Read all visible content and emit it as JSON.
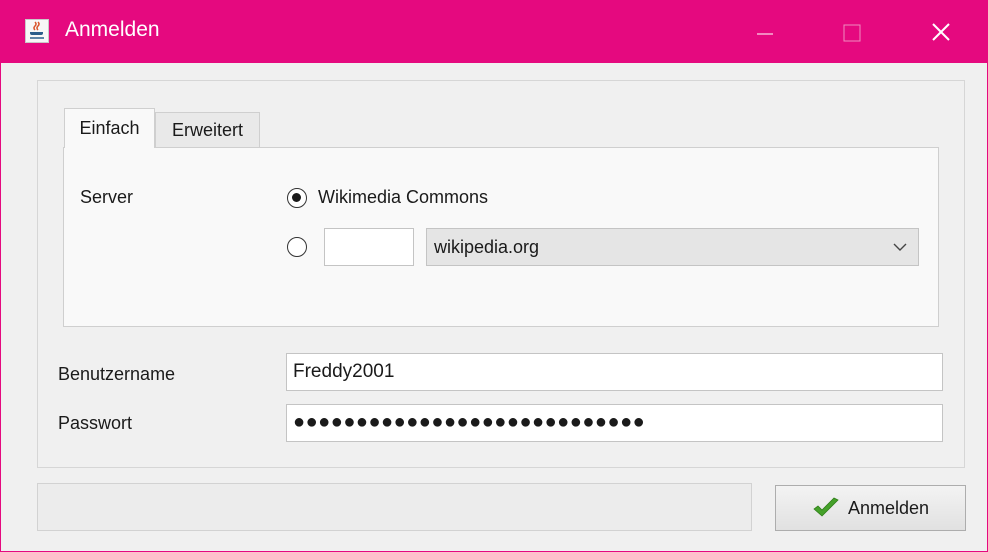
{
  "window": {
    "title": "Anmelden",
    "accent_color": "#e5097f",
    "app_icon": "java-cup-icon",
    "controls": [
      "minimize-icon",
      "maximize-icon",
      "close-icon"
    ]
  },
  "tabs": [
    {
      "label": "Einfach",
      "active": true
    },
    {
      "label": "Erweitert",
      "active": false
    }
  ],
  "server": {
    "label": "Server",
    "option_commons_label": "Wikimedia Commons",
    "option_commons_selected": true,
    "option_custom_selected": false,
    "custom_prefix_value": "",
    "domain_select_value": "wikipedia.org",
    "domain_select_icon": "chevron-down-icon"
  },
  "form": {
    "username_label": "Benutzername",
    "username_value": "Freddy2001",
    "password_label": "Passwort",
    "password_masked": "●●●●●●●●●●●●●●●●●●●●●●●●●●●●"
  },
  "status": {
    "message": ""
  },
  "actions": {
    "login_label": "Anmelden",
    "login_icon": "checkmark-icon"
  }
}
